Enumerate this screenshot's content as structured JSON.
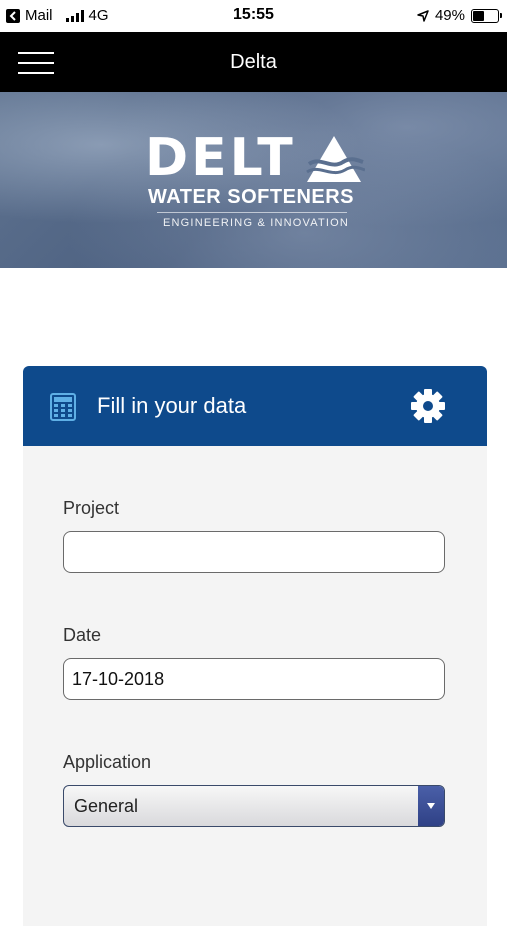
{
  "status_bar": {
    "back_app": "Mail",
    "network": "4G",
    "time": "15:55",
    "battery_percent": "49%",
    "battery_level": 0.49
  },
  "header": {
    "title": "Delta"
  },
  "hero": {
    "logo_main": "DELTA",
    "logo_sub": "WATER SOFTENERS",
    "logo_tagline": "ENGINEERING & INNOVATION"
  },
  "card": {
    "title": "Fill in your data",
    "icons": {
      "left": "calculator-icon",
      "right": "gear-icon"
    },
    "header_color": "#0e4a8c"
  },
  "form": {
    "project_label": "Project",
    "project_value": "",
    "date_label": "Date",
    "date_value": "17-10-2018",
    "application_label": "Application",
    "application_value": "General"
  }
}
